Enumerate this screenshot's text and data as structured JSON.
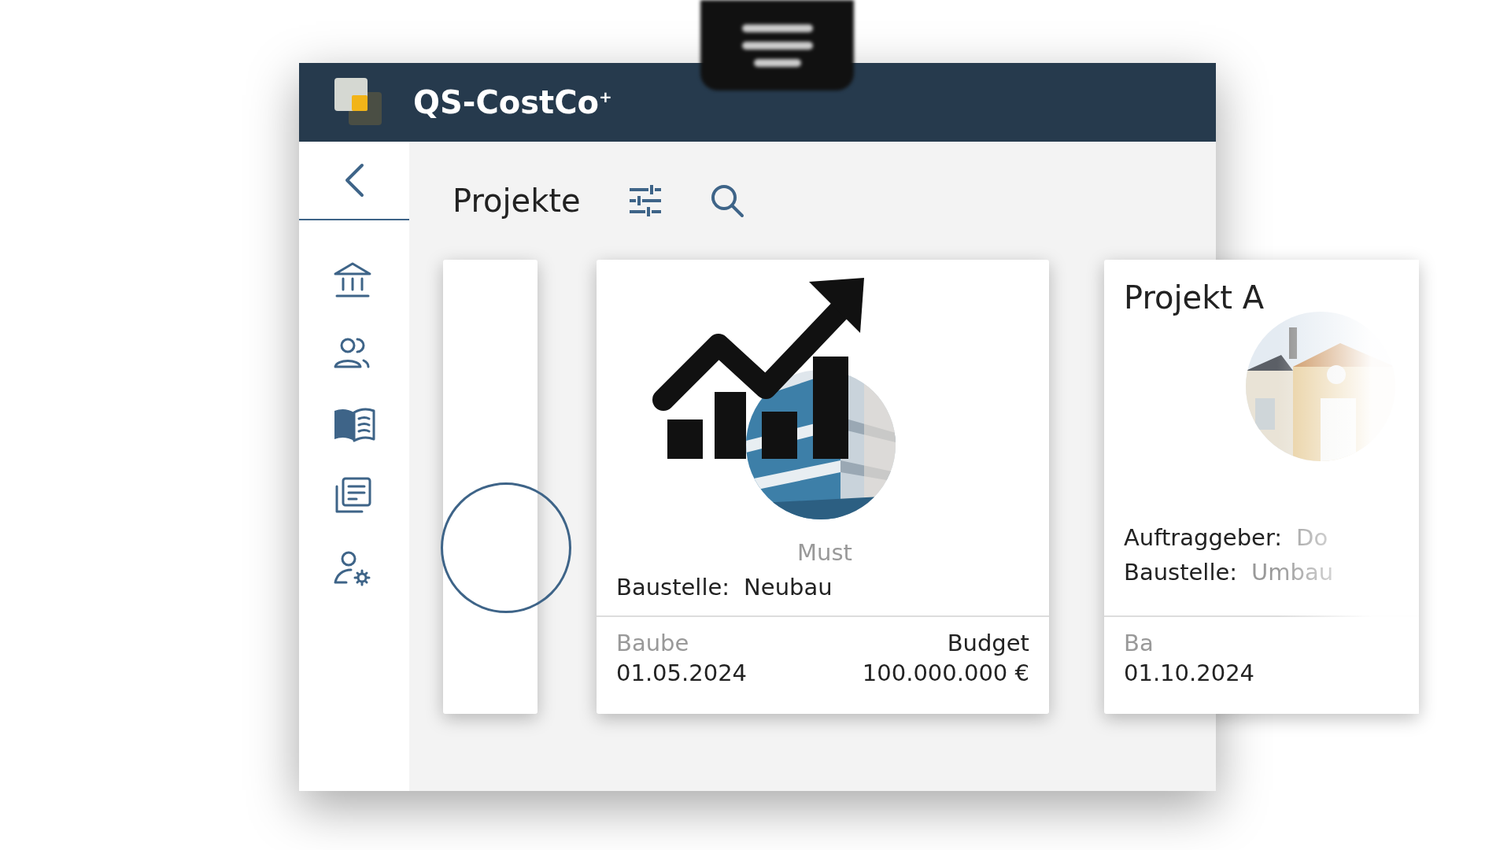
{
  "app": {
    "title": "QS-CostCo$^{+}$"
  },
  "sidebar": {
    "nav_items": [
      {
        "kind": "bank"
      },
      {
        "kind": "people"
      },
      {
        "kind": "book"
      },
      {
        "kind": "documents"
      },
      {
        "kind": "user-settings"
      }
    ]
  },
  "toolbar": {
    "title": "Projekte"
  },
  "cards": [
    {
      "kind": "blank"
    },
    {
      "kind": "chart",
      "client": "Must",
      "site_label": "Baustelle:",
      "site": "Neubau",
      "start_label": "Baube",
      "start": "01.05.2024",
      "budget_label": "Budget",
      "budget": "100.000.000 €"
    },
    {
      "kind": "project",
      "title": "Projekt A",
      "client_label": "Auftraggeber:",
      "client": "Do",
      "site_label": "Baustelle:",
      "site": "Umbau",
      "start_label": "Ba",
      "start": "01.10.2024"
    }
  ]
}
